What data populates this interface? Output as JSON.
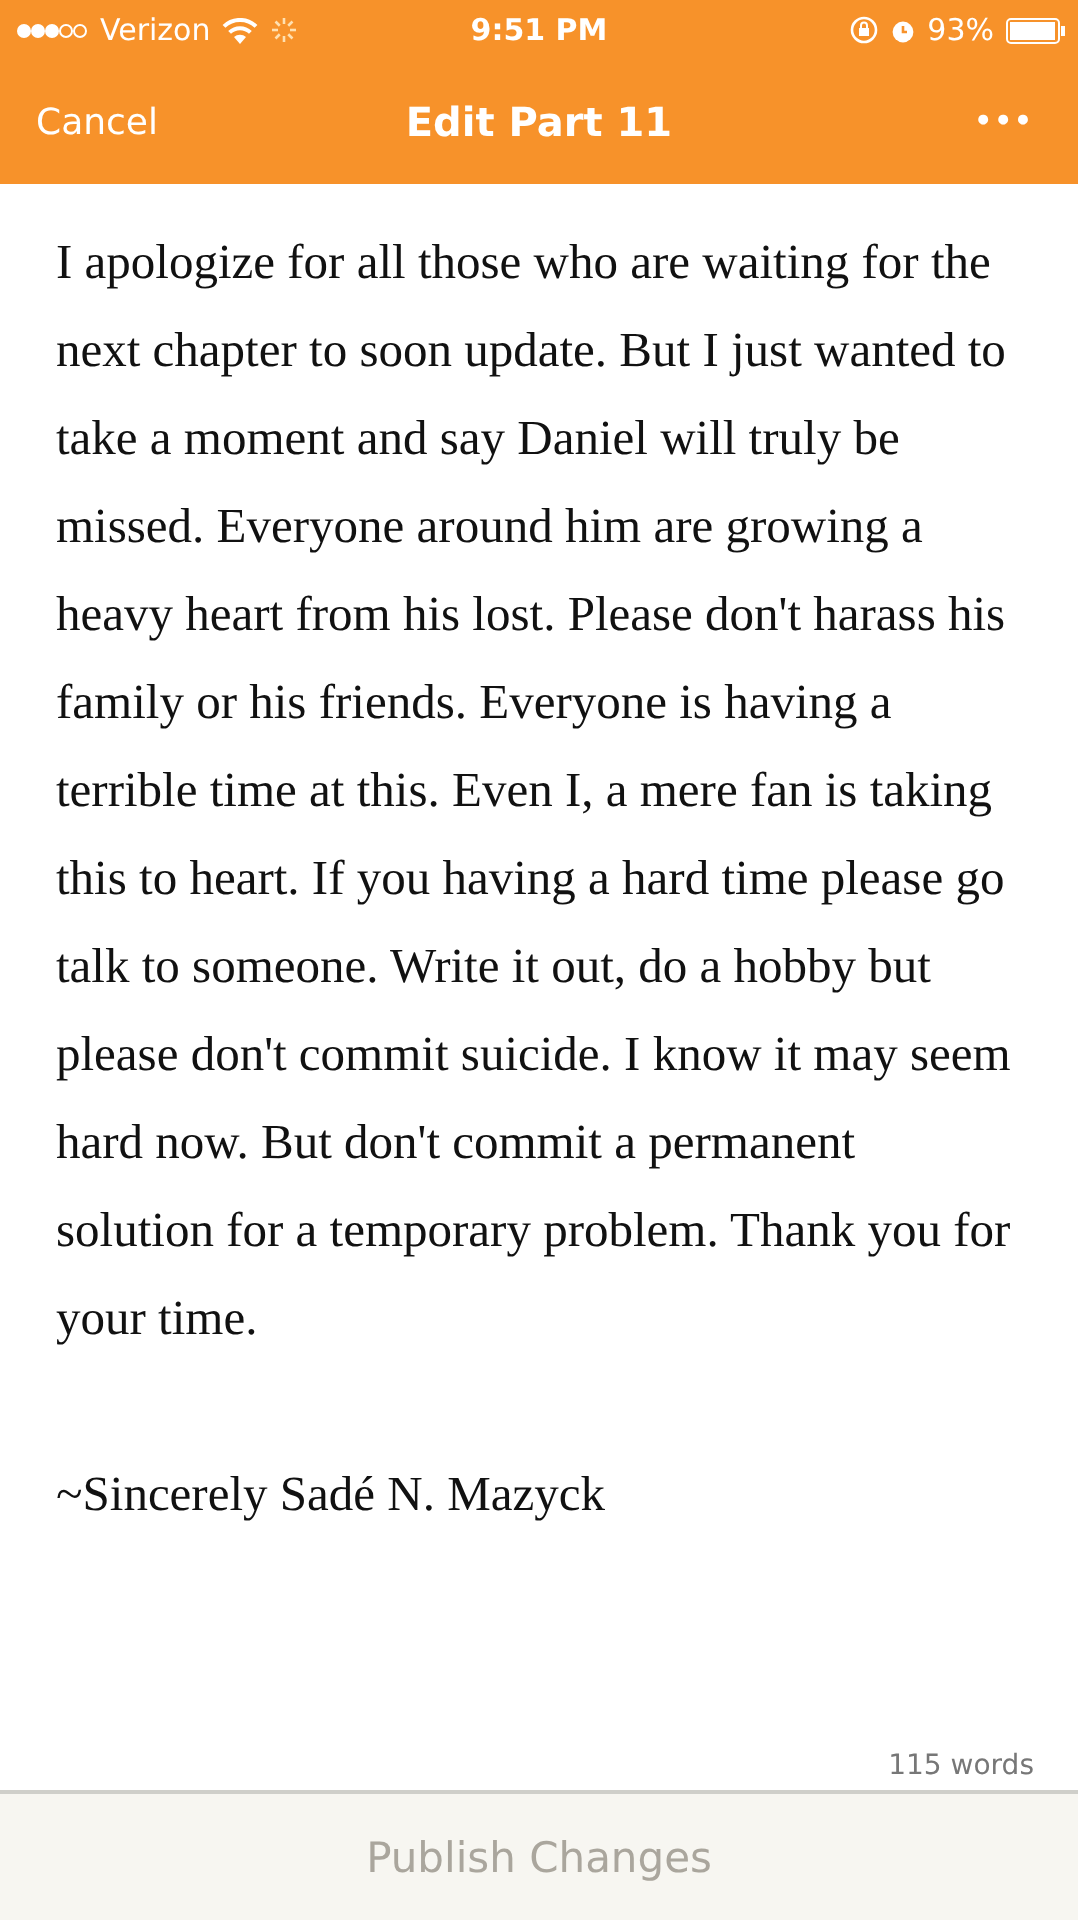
{
  "status_bar": {
    "carrier": "Verizon",
    "time": "9:51 PM",
    "battery_percent": "93%"
  },
  "nav_bar": {
    "left_button": "Cancel",
    "title": "Edit Part 11",
    "menu_button": "•••"
  },
  "body": {
    "paragraphs": [
      "I apologize for all those who are waiting for the next chapter to soon update. But I just wanted to take a moment and say Daniel will truly be missed. Everyone around him are growing a heavy heart from his lost. Please don't harass his family or his friends. Everyone is having a terrible time at this. Even I, a mere fan is taking this to heart. If you having a hard time please go talk to someone. Write it out, do a hobby but please don't commit suicide. I know it may seem hard now. But don't commit a permanent solution for a temporary problem. Thank you for your time.",
      "~Sincerely Sadé N. Mazyck"
    ]
  },
  "word_count": "115 words",
  "publish_button": {
    "label": "Publish Changes",
    "disabled": true
  }
}
